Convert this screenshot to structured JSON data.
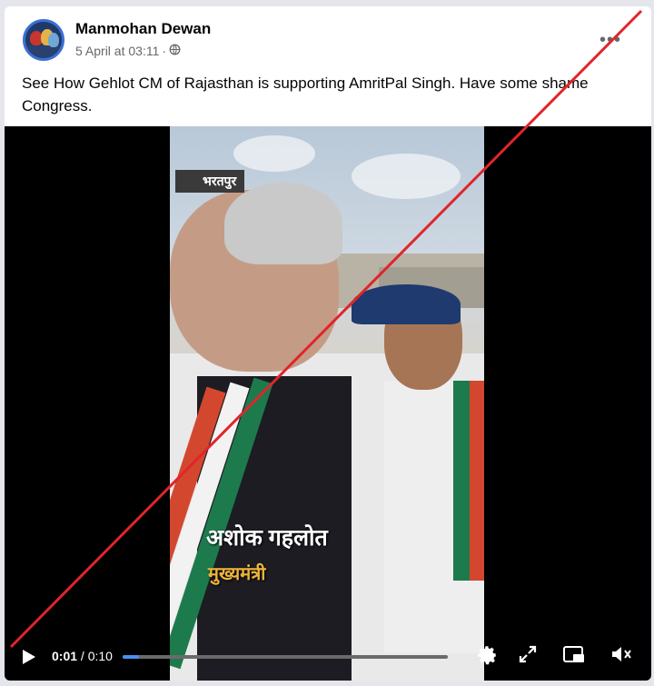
{
  "post": {
    "author": "Manmohan Dewan",
    "timestamp": "5 April at 03:11",
    "audience_separator": "·",
    "audience_icon": "globe-icon",
    "more_label": "•••",
    "caption": "See How Gehlot CM of Rajasthan is supporting AmritPal Singh. Have some shame Congress."
  },
  "video": {
    "overlay_place": "भरतपुर",
    "overlay_name": "अशोक गहलोत",
    "overlay_role": "मुख्यमंत्री",
    "current_time": "0:01",
    "separator": " / ",
    "duration": "0:10",
    "progress": 0.05,
    "controls": [
      "play-icon",
      "settings-icon",
      "expand-icon",
      "picture-in-picture-icon",
      "mute-icon"
    ]
  },
  "annotation": {
    "strike_color": "#e0252b"
  }
}
